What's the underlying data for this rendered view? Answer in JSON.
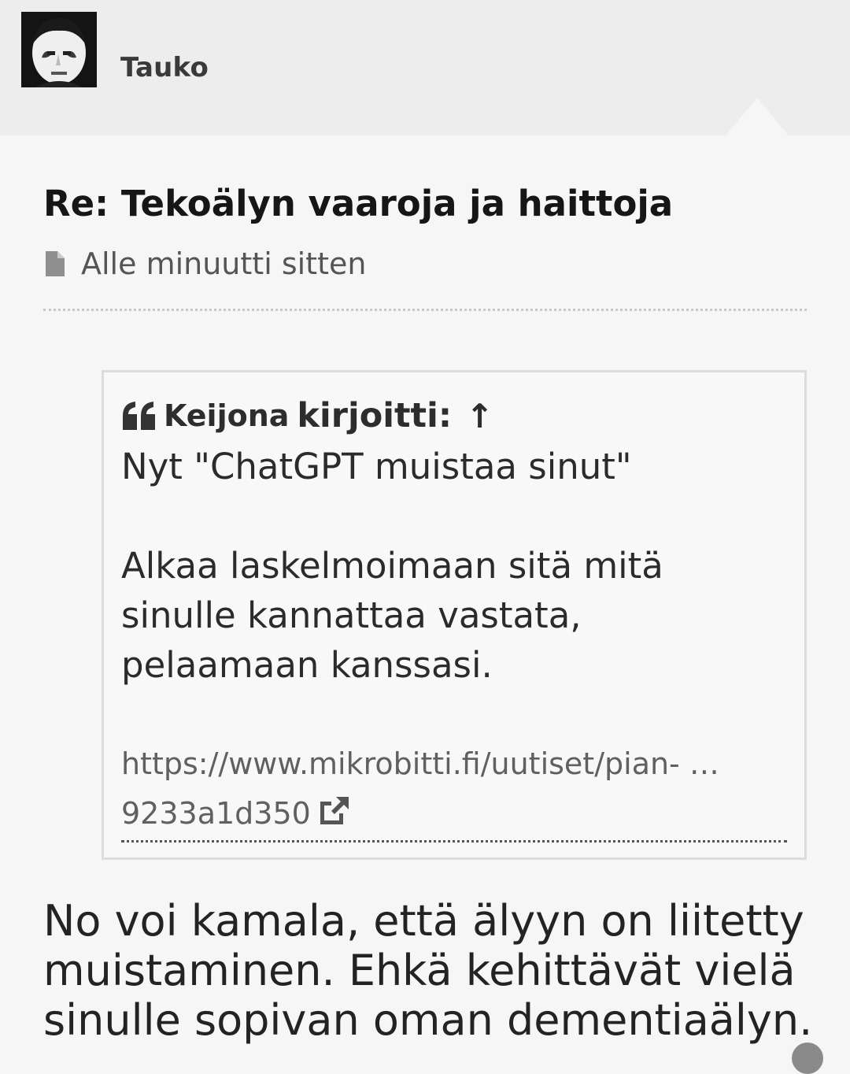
{
  "header": {
    "username": "Tauko"
  },
  "post": {
    "title": "Re: Tekoälyn vaaroja ja haittoja",
    "timestamp": "Alle minuutti sitten",
    "timestamp_icon": "document-icon"
  },
  "quote": {
    "icon": "quote-icon",
    "author": "Keijona",
    "wrote": "kirjoitti:",
    "jump_icon": "↑",
    "paragraphs": [
      "Nyt \"ChatGPT muistaa sinut\"",
      "Alkaa laskelmoimaan sitä mitä sinulle kannattaa vastata, pelaamaan kanssasi."
    ],
    "link_line1": "https://www.mikrobitti.fi/uutiset/pian- …",
    "link_line2": "9233a1d350",
    "link_icon": "external-link-icon"
  },
  "reply": {
    "text": "No voi kamala, että älyyn on liitetty muistaminen. Ehkä kehittävät vielä sinulle sopivan oman dementiaälyn."
  }
}
